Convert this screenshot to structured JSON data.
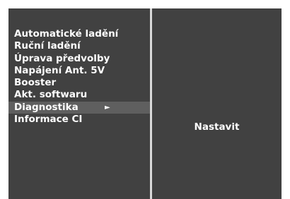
{
  "menu": {
    "items": [
      {
        "label": "Automatické ladění"
      },
      {
        "label": "Ruční ladění"
      },
      {
        "label": "Úprava předvolby"
      },
      {
        "label": "Napájení Ant. 5V"
      },
      {
        "label": "Booster"
      },
      {
        "label": "Akt. softwaru"
      },
      {
        "label": "Diagnostika",
        "selected": true
      },
      {
        "label": "Informace CI"
      }
    ],
    "selected_arrow": "►"
  },
  "submenu": {
    "label": "Nastavit"
  },
  "colors": {
    "panel_background": "#414141",
    "selected_row": "#5f5f5f",
    "divider": "#d9d9d9",
    "text": "#ffffff"
  },
  "icons": {
    "submenu_arrow": "right-arrow-icon"
  }
}
